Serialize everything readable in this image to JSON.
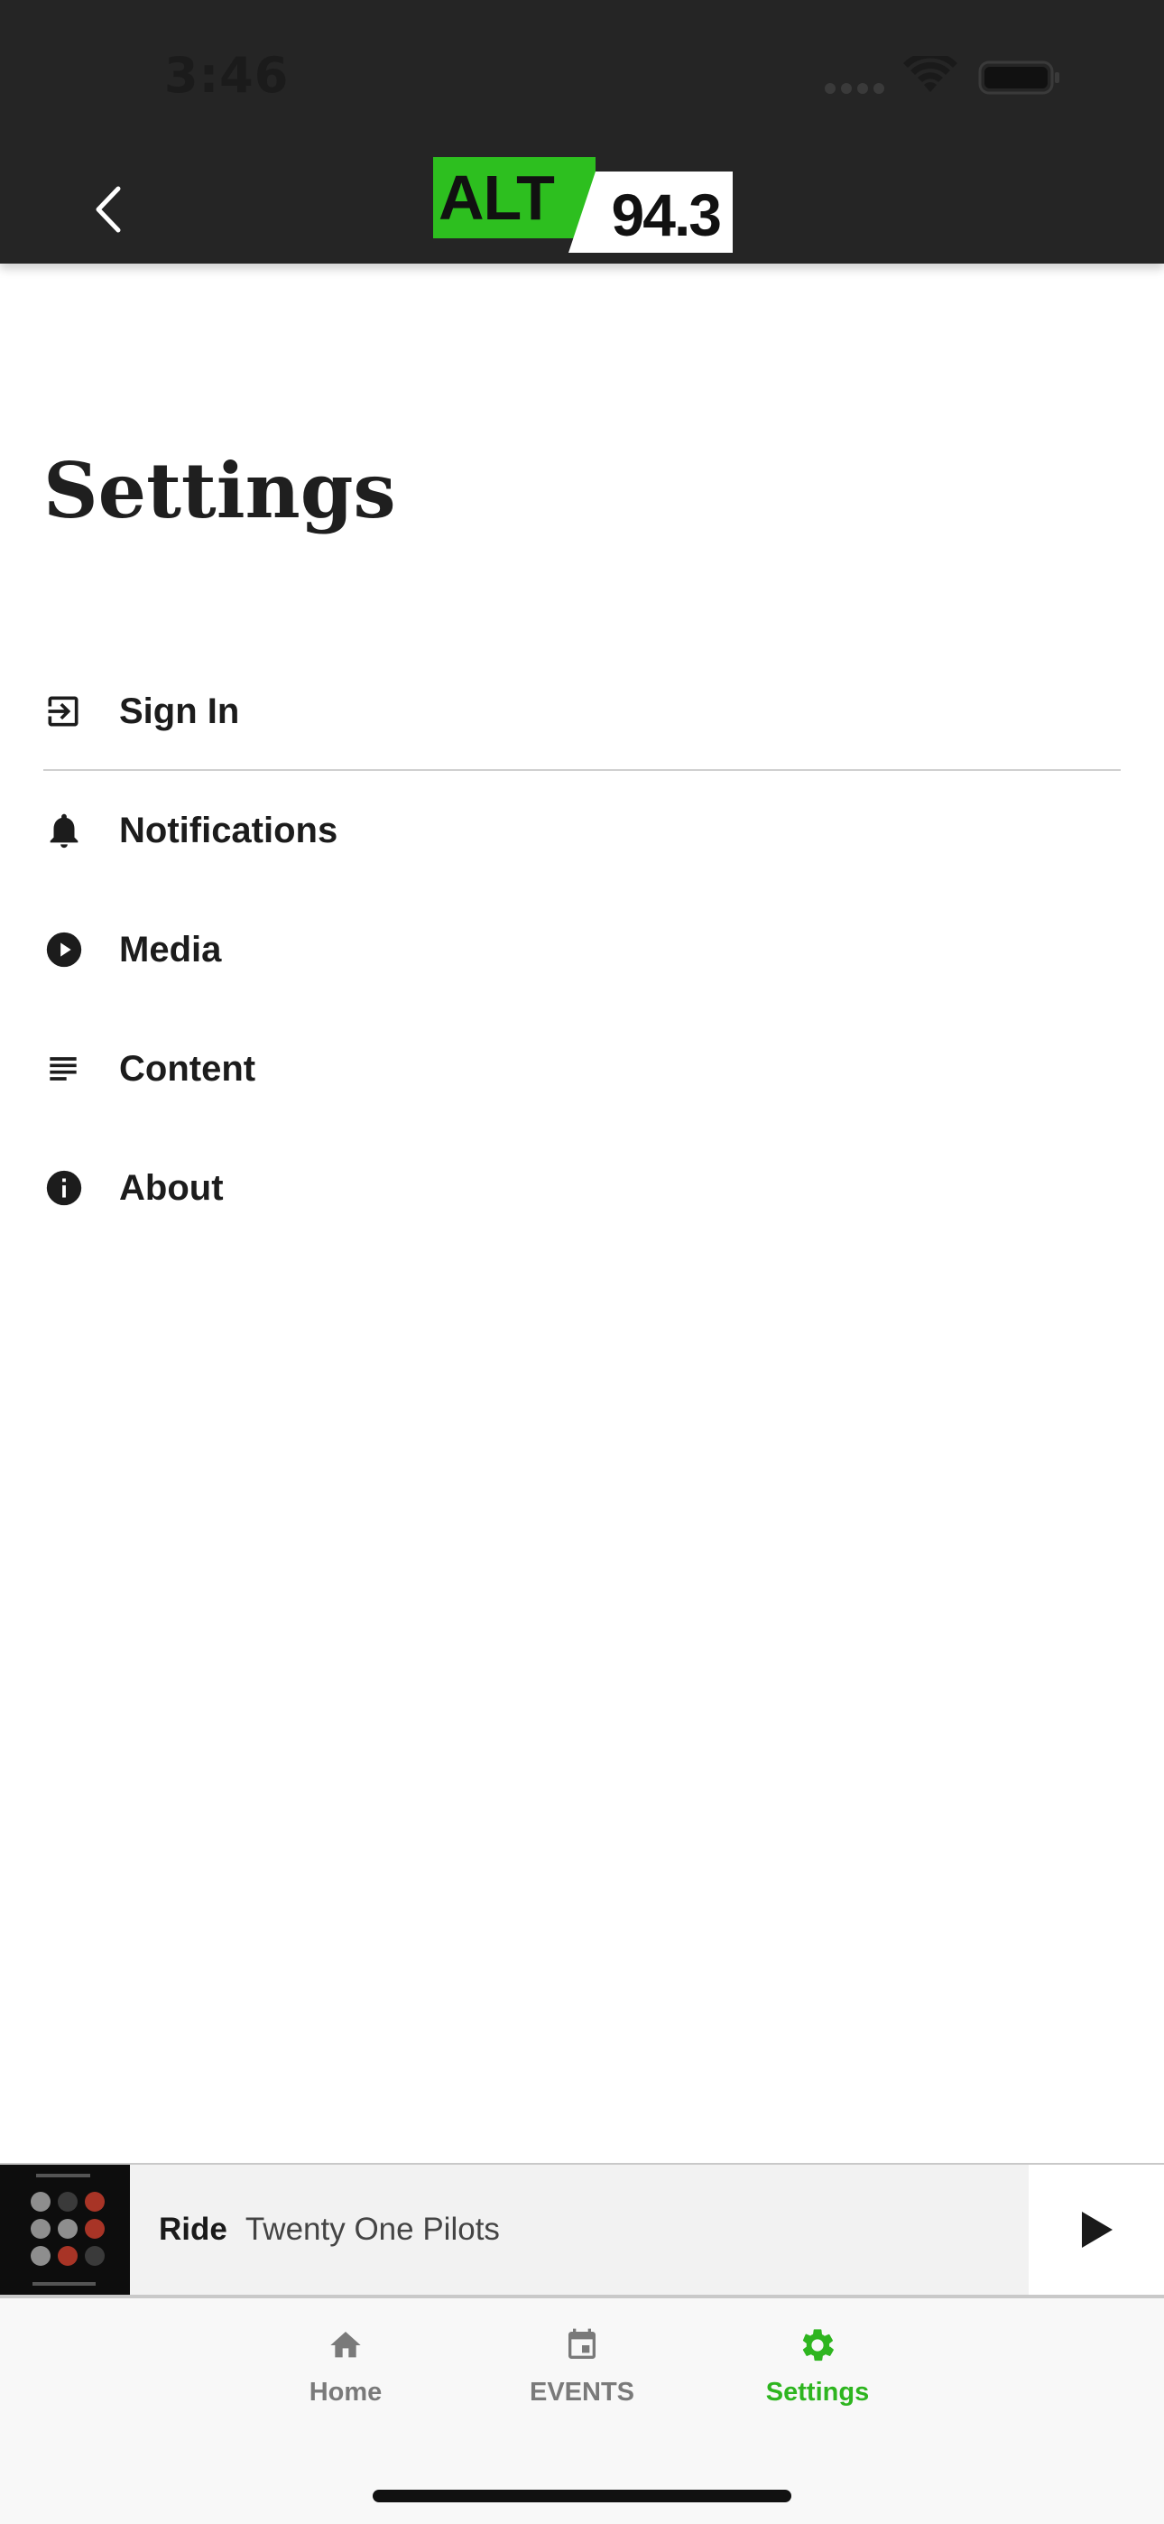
{
  "status_bar": {
    "time": "3:46"
  },
  "header": {
    "logo_alt_text": "ALT",
    "logo_freq_text": "94.3",
    "brand_color": "#2dbf1f"
  },
  "page": {
    "title": "Settings"
  },
  "settings_items": [
    {
      "label": "Sign In",
      "icon": "sign-in-icon"
    },
    {
      "label": "Notifications",
      "icon": "bell-icon"
    },
    {
      "label": "Media",
      "icon": "play-circle-icon"
    },
    {
      "label": "Content",
      "icon": "list-lines-icon"
    },
    {
      "label": "About",
      "icon": "info-icon"
    }
  ],
  "now_playing": {
    "title": "Ride",
    "artist": "Twenty One Pilots"
  },
  "tabs": [
    {
      "label": "Home",
      "icon": "home-icon",
      "active": false
    },
    {
      "label": "EVENTS",
      "icon": "calendar-icon",
      "active": false
    },
    {
      "label": "Settings",
      "icon": "gear-icon",
      "active": true
    }
  ],
  "colors": {
    "accent": "#2eb51f",
    "header_bg": "#252525"
  }
}
